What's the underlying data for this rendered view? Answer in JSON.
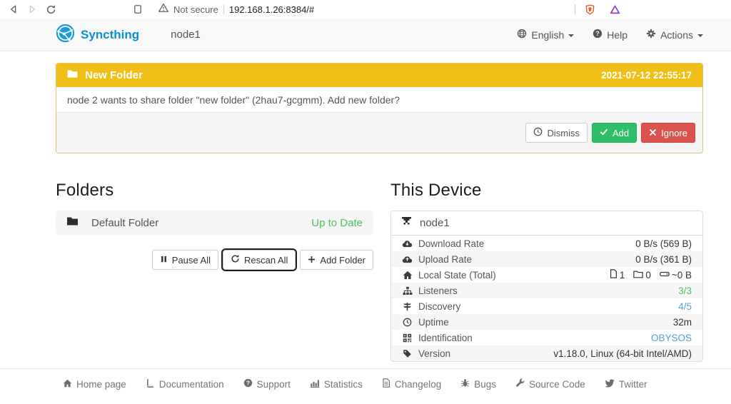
{
  "browser": {
    "security_label": "Not secure",
    "url": "192.168.1.26:8384/#"
  },
  "navbar": {
    "brand": "Syncthing",
    "page_title": "node1",
    "language_menu": "English",
    "help": "Help",
    "actions_menu": "Actions"
  },
  "notification_panel": {
    "title": "New Folder",
    "timestamp": "2021-07-12 22:55:17",
    "message": "node 2 wants to share folder \"new folder\" (2hau7-gcgmm). Add new folder?",
    "dismiss_label": "Dismiss",
    "add_label": "Add",
    "ignore_label": "Ignore"
  },
  "folders": {
    "heading": "Folders",
    "items": [
      {
        "name": "Default Folder",
        "status": "Up to Date"
      }
    ],
    "pause_all_label": "Pause All",
    "rescan_all_label": "Rescan All",
    "add_folder_label": "Add Folder"
  },
  "this_device": {
    "heading": "This Device",
    "device_name": "node1",
    "rows": [
      {
        "label": "Download Rate",
        "value": "0 B/s (569 B)"
      },
      {
        "label": "Upload Rate",
        "value": "0 B/s (361 B)"
      },
      {
        "label": "Local State (Total)",
        "files": "1",
        "directories": "0",
        "size": "~0 B"
      },
      {
        "label": "Listeners",
        "value": "3/3"
      },
      {
        "label": "Discovery",
        "value": "4/5"
      },
      {
        "label": "Uptime",
        "value": "32m"
      },
      {
        "label": "Identification",
        "value": "OBYSOS"
      },
      {
        "label": "Version",
        "value": "v1.18.0, Linux (64-bit Intel/AMD)"
      }
    ]
  },
  "footer": {
    "links": [
      {
        "label": "Home page"
      },
      {
        "label": "Documentation"
      },
      {
        "label": "Support"
      },
      {
        "label": "Statistics"
      },
      {
        "label": "Changelog"
      },
      {
        "label": "Bugs"
      },
      {
        "label": "Source Code"
      },
      {
        "label": "Twitter"
      }
    ]
  },
  "colors": {
    "brand_blue": "#0891d1",
    "warning_yellow": "#f0c019",
    "success_green": "#2fbf68",
    "danger_red": "#d9534f",
    "link_blue": "#51a0d8",
    "status_green": "#4cc35f"
  }
}
